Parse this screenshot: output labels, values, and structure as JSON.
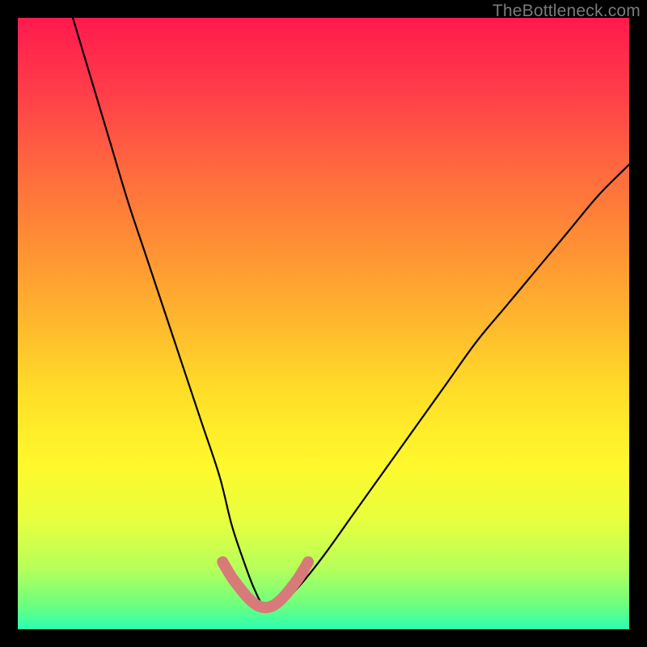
{
  "watermark": "TheBottleneck.com",
  "chart_data": {
    "type": "line",
    "title": "",
    "xlabel": "",
    "ylabel": "",
    "xlim": [
      0,
      100
    ],
    "ylim": [
      0,
      100
    ],
    "grid": false,
    "series": [
      {
        "name": "bottleneck-curve",
        "color": "#000000",
        "x": [
          9,
          12,
          15,
          18,
          21,
          24,
          27,
          30,
          33,
          35,
          37,
          38.5,
          40,
          41.5,
          43,
          46,
          50,
          55,
          60,
          65,
          70,
          75,
          80,
          85,
          90,
          95,
          100
        ],
        "y": [
          100,
          90,
          80,
          70,
          61,
          52,
          43,
          34,
          25,
          17,
          11,
          7,
          4,
          3,
          4,
          7,
          12,
          19,
          26,
          33,
          40,
          47,
          53,
          59,
          65,
          71,
          76
        ]
      },
      {
        "name": "highlight-bottom",
        "color": "#d87a7a",
        "x": [
          33.5,
          35,
          36.5,
          37.8,
          39,
          40,
          41,
          42,
          43.2,
          44.5,
          46,
          47.5
        ],
        "y": [
          11,
          8.5,
          6.5,
          5,
          4,
          3.6,
          3.6,
          4,
          5,
          6.5,
          8.5,
          11
        ]
      }
    ],
    "annotations": []
  }
}
